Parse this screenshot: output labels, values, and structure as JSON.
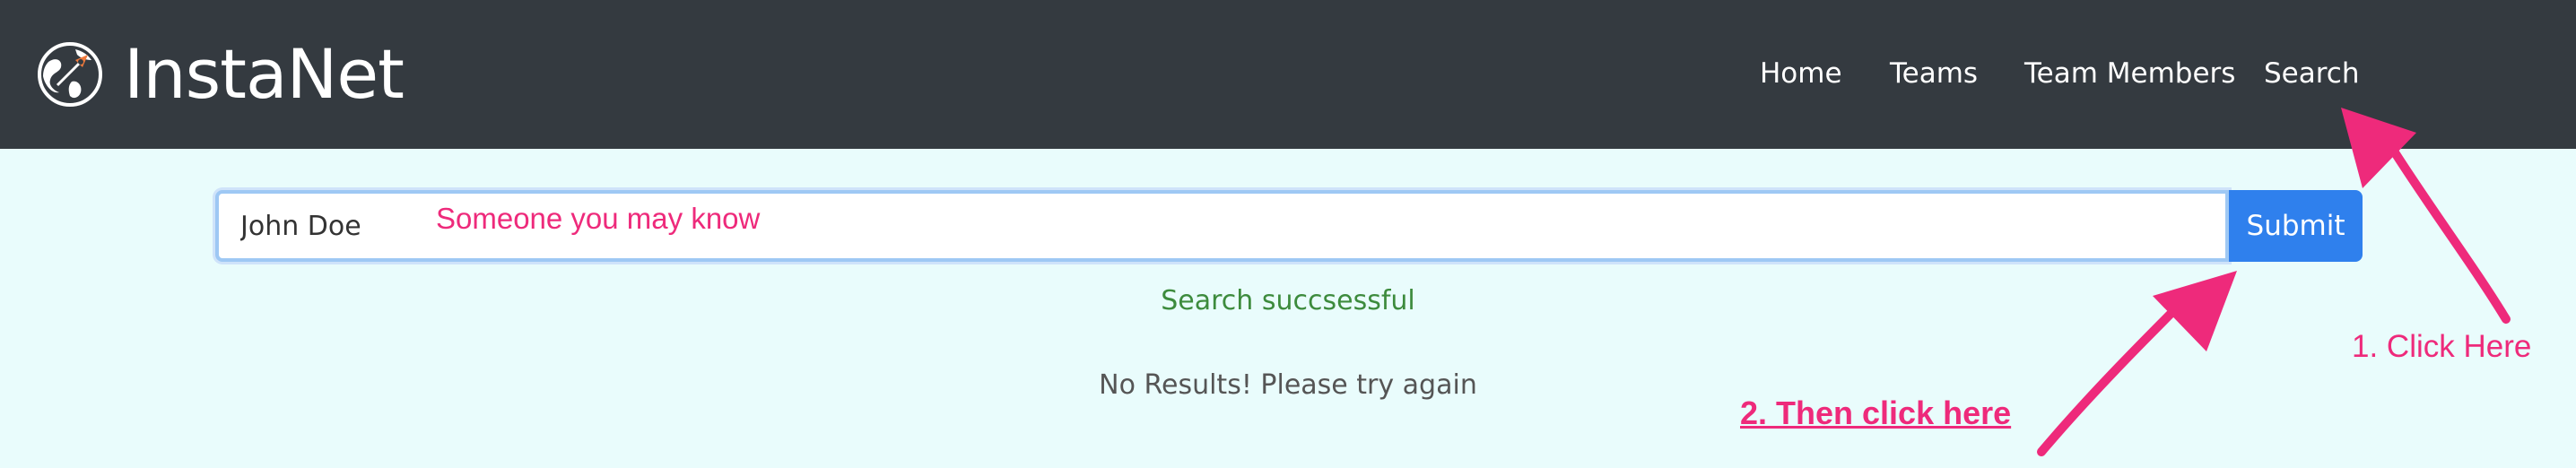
{
  "app": {
    "brand": "InstaNet",
    "brand_icon": "globe-rocket-icon"
  },
  "nav": {
    "items": [
      {
        "label": "Home"
      },
      {
        "label": "Teams"
      },
      {
        "label": "Team Members"
      },
      {
        "label": "Search"
      }
    ]
  },
  "search": {
    "value": "John Doe",
    "hint": "Someone you may know",
    "submit_label": "Submit"
  },
  "status": {
    "message": "Search succsessful",
    "result": "No Results! Please try again"
  },
  "annotations": {
    "step1": "1. Click Here",
    "step2": "2. Then click here"
  },
  "colors": {
    "navbar": "#343a40",
    "background": "#e9fcfc",
    "primary": "#2f80ed",
    "success": "#3d8b3d",
    "annotation": "#ee2a7b"
  }
}
